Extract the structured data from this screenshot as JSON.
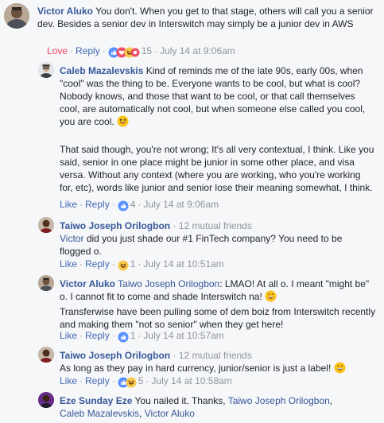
{
  "comment_main": {
    "author": "Victor Aluko",
    "text": "You don't. When you get to that stage, others will call you a senior dev. Besides a senior dev in Interswitch may simply be a junior dev in AWS",
    "action_love": "Love",
    "action_reply": "Reply",
    "reaction_count": "15",
    "timestamp": "July 14 at 9:06am",
    "reactions": [
      "like",
      "love",
      "haha",
      "wow"
    ]
  },
  "reply_1": {
    "author": "Caleb Mazalevskis",
    "para1": "Kind of reminds me of the late 90s, early 00s, when \"cool\" was the thing to be. Everyone wants to be cool, but what is cool? Nobody knows, and those that want to be cool, or that call themselves cool, are automatically not cool, but when someone else called you cool, you are cool.",
    "para2": "That said though, you're not wrong; It's all very contextual, I think. Like you said, senior in one place might be junior in some other place, and visa versa. Without any context (where you are working, who you're working for, etc), words like junior and senior lose their meaning somewhat, I think.",
    "action_like": "Like",
    "action_reply": "Reply",
    "reaction_count": "4",
    "timestamp": "July 14 at 9:06am",
    "reactions": [
      "like"
    ]
  },
  "reply_2": {
    "author": "Taiwo Joseph Orilogbon",
    "mutual": "12 mutual friends",
    "mention": "Victor",
    "text": "did you just shade our #1 FinTech company? You need to be flogged o.",
    "action_like": "Like",
    "action_reply": "Reply",
    "reaction_count": "1",
    "timestamp": "July 14 at 10:51am",
    "reactions": [
      "haha"
    ]
  },
  "reply_3": {
    "author": "Victor Aluko",
    "mention": "Taiwo Joseph Orilogbon",
    "text_a": ": LMAO! At all o. I meant \"might be\" o. I cannot fit to come and shade Interswitch na!",
    "text_b": "Transferwise have been pulling some of dem boiz from Interswitch recently and making them \"not so senior\" when they get here!",
    "action_like": "Like",
    "action_reply": "Reply",
    "reaction_count": "1",
    "timestamp": "July 14 at 10:57am",
    "reactions": [
      "like"
    ]
  },
  "reply_4": {
    "author": "Taiwo Joseph Orilogbon",
    "mutual": "12 mutual friends",
    "text": "As long as they pay in hard currency, junior/senior is just a label!",
    "action_like": "Like",
    "action_reply": "Reply",
    "reaction_count": "5",
    "timestamp": "July 14 at 10:58am",
    "reactions": [
      "like",
      "haha"
    ]
  },
  "reply_5": {
    "author": "Eze Sunday Eze",
    "text": "You nailed it. Thanks,",
    "mention_1": "Taiwo Joseph Orilogbon",
    "mention_2": "Caleb Mazalevskis",
    "mention_3": "Victor Aluko",
    "sep": ","
  },
  "colors": {
    "link": "#365899",
    "action": "#4267b2",
    "love": "#f33e58",
    "meta": "#90949c",
    "background": "#f6f7f9"
  }
}
